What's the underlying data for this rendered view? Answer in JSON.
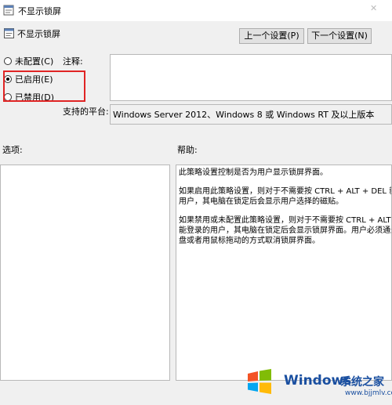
{
  "window": {
    "title": "不显示锁屏"
  },
  "header": {
    "title": "不显示锁屏"
  },
  "nav": {
    "prev_label": "上一个设置(P)",
    "next_label": "下一个设置(N)"
  },
  "state": {
    "options": [
      {
        "label": "未配置(C)",
        "checked": false
      },
      {
        "label": "已启用(E)",
        "checked": true
      },
      {
        "label": "已禁用(D)",
        "checked": false
      }
    ]
  },
  "comment": {
    "label": "注释:",
    "value": ""
  },
  "supported": {
    "label": "支持的平台:",
    "value": "Windows Server 2012、Windows 8 或 Windows RT 及以上版本"
  },
  "options_panel": {
    "label": "选项:"
  },
  "help": {
    "label": "帮助:",
    "paragraphs": [
      "此策略设置控制是否为用户显示锁屏界面。",
      "如果启用此策略设置，则对于不需要按 CTRL + ALT + DEL 就\n用户，其电脑在锁定后会显示用户选择的磁贴。",
      "如果禁用或未配置此策略设置，则对于不需要按 CTRL + ALT +\n能登录的用户，其电脑在锁定后会显示锁屏界面。用户必须通过\n盘或者用鼠标拖动的方式取消锁屏界面。"
    ]
  },
  "watermark": {
    "brand": "Windows",
    "cn": "系统之家",
    "url": "www.bjjmlv.com"
  },
  "colors": {
    "highlight_box": "#e02424",
    "dialog_bg": "#f0f0f0",
    "watermark": "#1a4fa0"
  }
}
